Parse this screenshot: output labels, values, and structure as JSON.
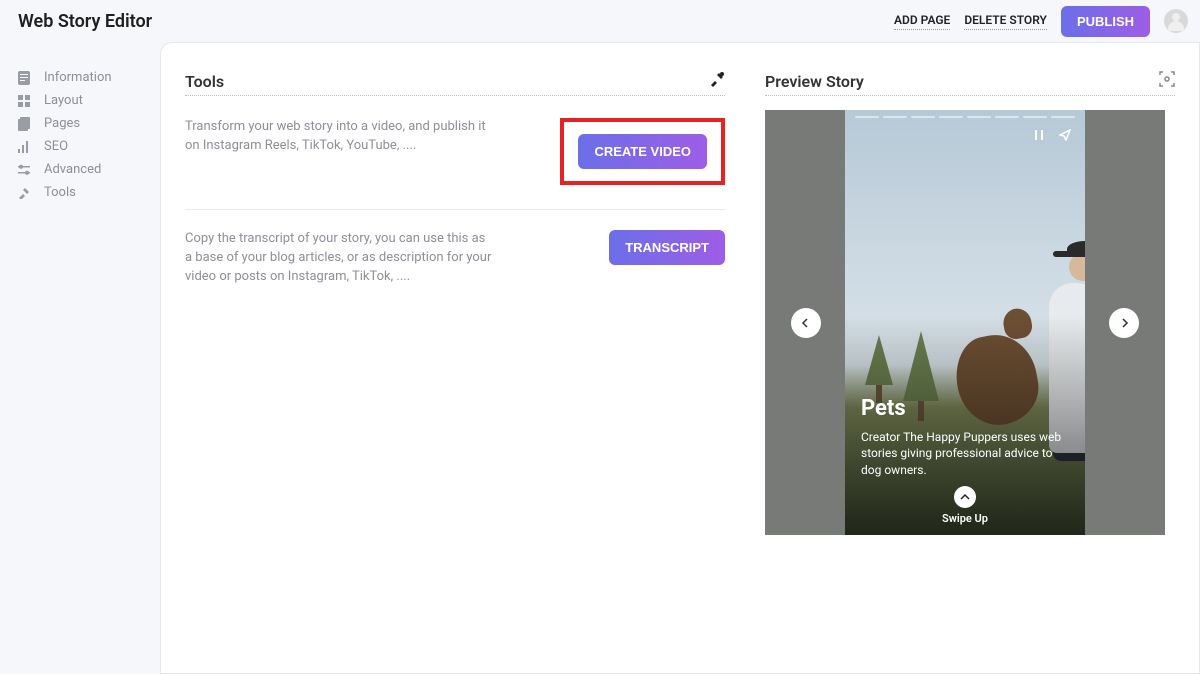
{
  "header": {
    "app_title": "Web Story Editor",
    "add_page": "ADD PAGE",
    "delete_story": "DELETE STORY",
    "publish": "PUBLISH"
  },
  "sidebar": {
    "items": [
      {
        "label": "Information"
      },
      {
        "label": "Layout"
      },
      {
        "label": "Pages"
      },
      {
        "label": "SEO"
      },
      {
        "label": "Advanced"
      },
      {
        "label": "Tools"
      }
    ]
  },
  "tools": {
    "panel_title": "Tools",
    "rows": [
      {
        "desc": "Transform your web story into a video, and publish it on Instagram Reels, TikTok, YouTube, ....",
        "button": "CREATE VIDEO"
      },
      {
        "desc": "Copy the transcript of your story, you can use this as a base of your blog articles, or as description for your video or posts on Instagram, TikTok, ....",
        "button": "TRANSCRIPT"
      }
    ]
  },
  "preview": {
    "panel_title": "Preview Story",
    "story": {
      "heading": "Pets",
      "subheading": "Creator The Happy Puppers uses web stories giving professional advice to dog owners.",
      "swipe": "Swipe Up"
    }
  }
}
